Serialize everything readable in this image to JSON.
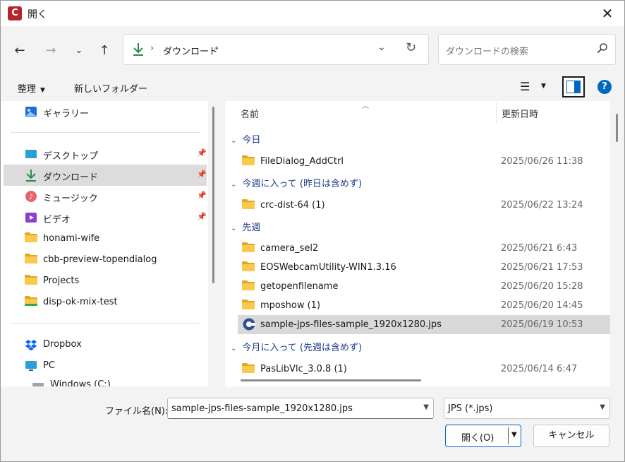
{
  "window": {
    "title": "開く",
    "app_icon_letter": "C"
  },
  "nav": {
    "back_icon": "arrow-left-icon",
    "forward_icon": "arrow-right-icon",
    "recent_icon": "chevron-down-icon",
    "up_icon": "arrow-up-icon",
    "breadcrumb": [
      "ダウンロード"
    ],
    "search_placeholder": "ダウンロードの検索"
  },
  "toolbar": {
    "organize_label": "整理",
    "new_folder_label": "新しいフォルダー"
  },
  "sidebar": {
    "items": [
      {
        "label": "ギャラリー",
        "icon": "gallery-icon"
      },
      {
        "label": "デスクトップ",
        "icon": "desktop-icon",
        "pinned": true
      },
      {
        "label": "ダウンロード",
        "icon": "download-icon",
        "pinned": true,
        "selected": true
      },
      {
        "label": "ミュージック",
        "icon": "music-icon",
        "pinned": true
      },
      {
        "label": "ビデオ",
        "icon": "video-icon",
        "pinned": true
      },
      {
        "label": "honami-wife",
        "icon": "folder-icon"
      },
      {
        "label": "cbb-preview-topendialog",
        "icon": "folder-icon"
      },
      {
        "label": "Projects",
        "icon": "folder-icon"
      },
      {
        "label": "disp-ok-mix-test",
        "icon": "folder-icon"
      },
      {
        "label": "Dropbox",
        "icon": "dropbox-icon"
      },
      {
        "label": "PC",
        "icon": "pc-icon"
      },
      {
        "label": "Windows (C:)",
        "icon": "drive-icon"
      }
    ]
  },
  "list": {
    "columns": {
      "name": "名前",
      "date": "更新日時"
    },
    "groups": [
      {
        "label": "今日",
        "items": [
          {
            "name": "FileDialog_AddCtrl",
            "date": "2025/06/26 11:38",
            "type": "folder"
          }
        ]
      },
      {
        "label": "今週に入って (昨日は含めず)",
        "items": [
          {
            "name": "crc-dist-64 (1)",
            "date": "2025/06/22 13:24",
            "type": "folder"
          }
        ]
      },
      {
        "label": "先週",
        "items": [
          {
            "name": "camera_sel2",
            "date": "2025/06/21 6:43",
            "type": "folder"
          },
          {
            "name": "EOSWebcamUtility-WIN1.3.16",
            "date": "2025/06/21 17:53",
            "type": "folder"
          },
          {
            "name": "getopenfilename",
            "date": "2025/06/20 15:28",
            "type": "folder"
          },
          {
            "name": "mposhow (1)",
            "date": "2025/06/20 14:45",
            "type": "folder"
          },
          {
            "name": "sample-jps-files-sample_1920x1280.jps",
            "date": "2025/06/19 10:53",
            "type": "jps",
            "selected": true
          }
        ]
      },
      {
        "label": "今月に入って (先週は含めず)",
        "items": [
          {
            "name": "PasLibVlc_3.0.8 (1)",
            "date": "2025/06/14 6:47",
            "type": "folder"
          }
        ]
      }
    ]
  },
  "bottom": {
    "filename_label": "ファイル名(N):",
    "filename_value": "sample-jps-files-sample_1920x1280.jps",
    "filetype_value": "JPS (*.jps)",
    "open_label": "開く(O)",
    "cancel_label": "キャンセル"
  },
  "colors": {
    "accent": "#0067c0",
    "folder": "#f8c94a",
    "group_header": "#1d3b87"
  }
}
